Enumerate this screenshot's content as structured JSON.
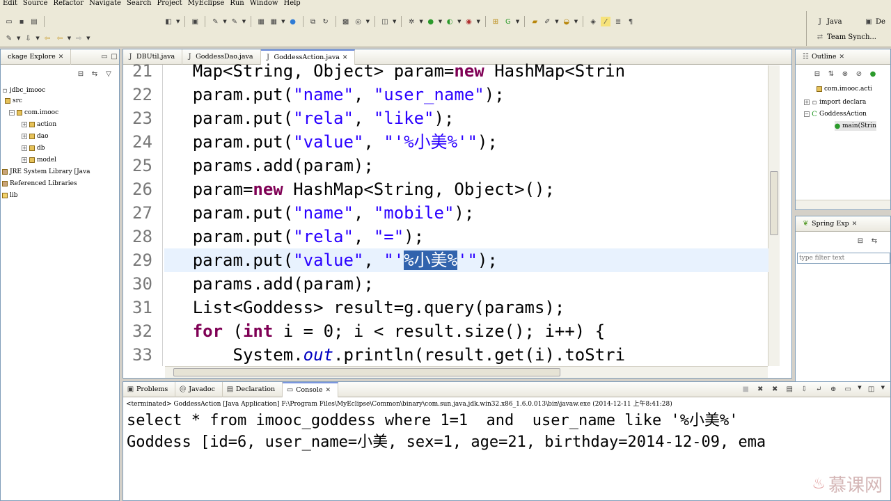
{
  "menu": [
    "Edit",
    "Source",
    "Refactor",
    "Navigate",
    "Search",
    "Project",
    "MyEclipse",
    "Run",
    "Window",
    "Help"
  ],
  "perspective": {
    "java_label": "Java",
    "de_label": "De",
    "team_sync_label": "Team Synch..."
  },
  "package_explorer": {
    "title": "ckage Explore",
    "items": [
      {
        "label": "jdbc_imooc"
      },
      {
        "label": "src"
      },
      {
        "label": "com.imooc"
      },
      {
        "label": "action"
      },
      {
        "label": "dao"
      },
      {
        "label": "db"
      },
      {
        "label": "model"
      },
      {
        "label": "JRE System Library [Java"
      },
      {
        "label": "Referenced Libraries"
      },
      {
        "label": "lib"
      }
    ]
  },
  "editor": {
    "tabs": [
      {
        "label": "DBUtil.java",
        "active": false
      },
      {
        "label": "GoddessDao.java",
        "active": false
      },
      {
        "label": "GoddessAction.java",
        "active": true
      }
    ],
    "lines": [
      {
        "n": "21",
        "parts": [
          [
            "t",
            "    Map<String, Object> param="
          ],
          [
            "k",
            "new"
          ],
          [
            "t",
            " HashMap<Strin"
          ]
        ]
      },
      {
        "n": "22",
        "parts": [
          [
            "t",
            "    param.put("
          ],
          [
            "s",
            "\"name\""
          ],
          [
            "t",
            ", "
          ],
          [
            "s",
            "\"user_name\""
          ],
          [
            "t",
            ");"
          ]
        ]
      },
      {
        "n": "23",
        "parts": [
          [
            "t",
            "    param.put("
          ],
          [
            "s",
            "\"rela\""
          ],
          [
            "t",
            ", "
          ],
          [
            "s",
            "\"like\""
          ],
          [
            "t",
            ");"
          ]
        ]
      },
      {
        "n": "24",
        "parts": [
          [
            "t",
            "    param.put("
          ],
          [
            "s",
            "\"value\""
          ],
          [
            "t",
            ", "
          ],
          [
            "s",
            "\"'%小美%'\""
          ],
          [
            "t",
            ");"
          ]
        ]
      },
      {
        "n": "25",
        "parts": [
          [
            "t",
            "    params.add(param);"
          ]
        ]
      },
      {
        "n": "26",
        "parts": [
          [
            "t",
            "    param="
          ],
          [
            "k",
            "new"
          ],
          [
            "t",
            " HashMap<String, Object>();"
          ]
        ]
      },
      {
        "n": "27",
        "parts": [
          [
            "t",
            "    param.put("
          ],
          [
            "s",
            "\"name\""
          ],
          [
            "t",
            ", "
          ],
          [
            "s",
            "\"mobile\""
          ],
          [
            "t",
            ");"
          ]
        ]
      },
      {
        "n": "28",
        "parts": [
          [
            "t",
            "    param.put("
          ],
          [
            "s",
            "\"rela\""
          ],
          [
            "t",
            ", "
          ],
          [
            "s",
            "\"=\""
          ],
          [
            "t",
            ");"
          ]
        ]
      },
      {
        "n": "29",
        "parts": [
          [
            "t",
            "    param.put("
          ],
          [
            "s",
            "\"value\""
          ],
          [
            "t",
            ", "
          ],
          [
            "s",
            "\"'"
          ],
          [
            "sel",
            "%小美%"
          ],
          [
            "s",
            "'\""
          ],
          [
            "t",
            ");"
          ]
        ]
      },
      {
        "n": "30",
        "parts": [
          [
            "t",
            "    params.add(param);"
          ]
        ]
      },
      {
        "n": "31",
        "parts": [
          [
            "t",
            "    List<Goddess> result=g.query(params);"
          ]
        ]
      },
      {
        "n": "32",
        "parts": [
          [
            "t",
            "    "
          ],
          [
            "k",
            "for"
          ],
          [
            "t",
            " ("
          ],
          [
            "k",
            "int"
          ],
          [
            "t",
            " i = 0; i < result.size(); i++) {"
          ]
        ]
      },
      {
        "n": "33",
        "parts": [
          [
            "t",
            "        System."
          ],
          [
            "i",
            "out"
          ],
          [
            "t",
            ".println(result.get(i).toStri"
          ]
        ]
      }
    ]
  },
  "outline": {
    "title": "Outline",
    "items": [
      {
        "label": "com.imooc.acti"
      },
      {
        "label": "import declara"
      },
      {
        "label": "GoddessAction"
      },
      {
        "label": "main(Strin"
      }
    ]
  },
  "spring_explorer": {
    "title": "Spring Exp",
    "filter_placeholder": "type filter text"
  },
  "bottom_tabs": [
    {
      "label": "Problems",
      "active": false
    },
    {
      "label": "Javadoc",
      "active": false
    },
    {
      "label": "Declaration",
      "active": false
    },
    {
      "label": "Console",
      "active": true
    }
  ],
  "console": {
    "status": "<terminated> GoddessAction [Java Application] F:\\Program Files\\MyEclipse\\Common\\binary\\com.sun.java.jdk.win32.x86_1.6.0.013\\bin\\javaw.exe (2014-12-11 上午8:41:28)",
    "lines": [
      "select * from imooc_goddess where 1=1  and  user_name like '%小美%'",
      "Goddess [id=6, user_name=小美, sex=1, age=21, birthday=2014-12-09, ema"
    ]
  },
  "watermark": "慕课网"
}
